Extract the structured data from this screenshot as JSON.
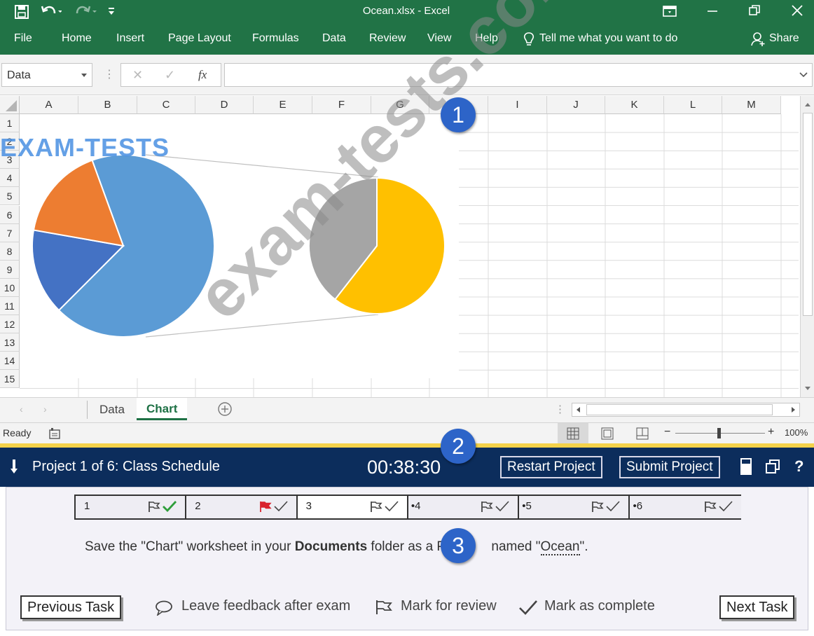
{
  "window": {
    "title": "Ocean.xlsx  -  Excel"
  },
  "ribbon": {
    "tabs": [
      "File",
      "Home",
      "Insert",
      "Page Layout",
      "Formulas",
      "Data",
      "Review",
      "View",
      "Help"
    ],
    "tell_me": "Tell me what you want to do",
    "share": "Share"
  },
  "formula_bar": {
    "name_box": "Data",
    "fx": "fx",
    "content": ""
  },
  "grid": {
    "columns": [
      "A",
      "B",
      "C",
      "D",
      "E",
      "F",
      "G",
      "H",
      "I",
      "J",
      "K",
      "L",
      "M"
    ],
    "rows": [
      "1",
      "2",
      "3",
      "4",
      "5",
      "6",
      "7",
      "8",
      "9",
      "10",
      "11",
      "12",
      "13",
      "14",
      "15"
    ]
  },
  "chart_data": {
    "type": "pie",
    "title": "",
    "main_pie": {
      "slice_colors": [
        "#5b9bd5",
        "#4472c4",
        "#ed7d31"
      ]
    },
    "secondary_pie": {
      "slice_colors": [
        "#ffc000",
        "#a5a5a5"
      ]
    }
  },
  "sheets": {
    "tabs": [
      "Data",
      "Chart"
    ],
    "active": "Chart"
  },
  "status": {
    "ready": "Ready",
    "zoom": "100%"
  },
  "exam": {
    "project": "Project 1 of 6: Class Schedule",
    "timer": "00:38:30",
    "restart": "Restart Project",
    "submit": "Submit Project",
    "help": "?",
    "tasks": [
      {
        "num": "1",
        "bullet": ""
      },
      {
        "num": "2",
        "bullet": ""
      },
      {
        "num": "3",
        "bullet": ""
      },
      {
        "num": "4",
        "bullet": "•"
      },
      {
        "num": "5",
        "bullet": "•"
      },
      {
        "num": "6",
        "bullet": "•"
      }
    ],
    "instruction_pre": "Save the \"Chart\" worksheet in your ",
    "instruction_bold": "Documents",
    "instruction_mid": " folder as a P",
    "instruction_post": " named \"",
    "instruction_name": "Ocean",
    "instruction_end": "\".",
    "previous": "Previous Task",
    "feedback": "Leave feedback after exam",
    "review": "Mark for review",
    "complete": "Mark as complete",
    "next": "Next Task"
  },
  "badges": [
    "1",
    "2",
    "3"
  ],
  "watermarks": {
    "top": "EXAM-TESTS",
    "diagonal": "exam-tests.com"
  },
  "colors": {
    "excel_green": "#217346",
    "exam_navy": "#0c2d5c",
    "badge_blue": "#2d64c8",
    "active_tab": "#1e7145",
    "flag_red": "#d9232e",
    "check_green": "#2e9e3a"
  }
}
